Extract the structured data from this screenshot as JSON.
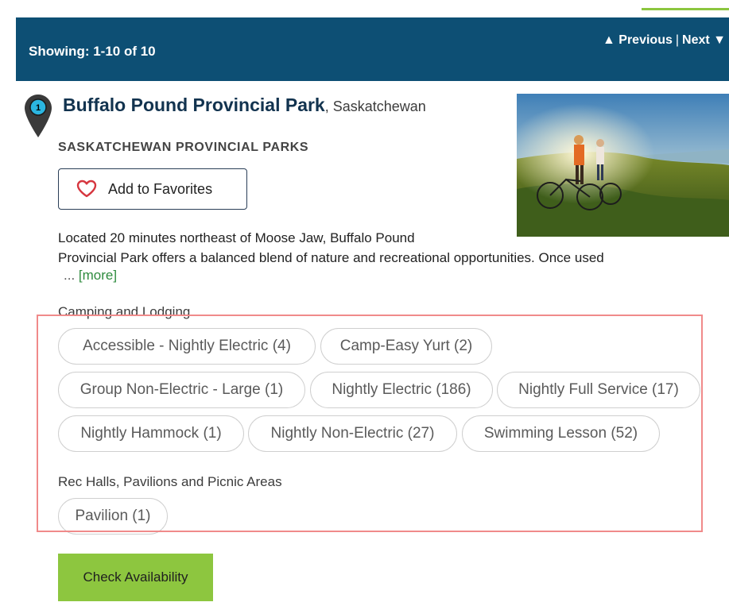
{
  "results": {
    "showing": "Showing: 1-10 of 10",
    "previous_label": "▲ Previous",
    "separator": "|",
    "next_label": "Next ▼"
  },
  "park": {
    "marker_number": "1",
    "name": "Buffalo Pound Provincial Park",
    "province": ", Saskatchewan",
    "organization": "SASKATCHEWAN PROVINCIAL PARKS",
    "favorite_label": "Add to Favorites",
    "description_line1": "Located 20 minutes northeast of Moose Jaw, Buffalo Pound",
    "description_line2": "Provincial Park offers a balanced blend of nature and recreational opportunities. Once used",
    "ellipsis": "...",
    "more_label": "[more]",
    "check_label": "Check Availability"
  },
  "sections": [
    {
      "label": "Camping and Lodging",
      "chips": [
        "Accessible - Nightly Electric (4)",
        "Camp-Easy Yurt (2)",
        "Group Non-Electric - Large (1)",
        "Nightly Electric (186)",
        "Nightly Full Service (17)",
        "Nightly Hammock (1)",
        "Nightly Non-Electric (27)",
        "Swimming Lesson (52)"
      ]
    },
    {
      "label": "Rec Halls, Pavilions and Picnic Areas",
      "chips": [
        "Pavilion (1)"
      ]
    }
  ],
  "colors": {
    "header_bg": "#0d4f74",
    "accent_green": "#8dc63f",
    "heart_red": "#d6363f",
    "highlight_red": "#f08a8a",
    "marker_cyan": "#2bb5e0"
  },
  "icons": {
    "marker": "map-pin-icon",
    "favorite": "heart-icon"
  }
}
